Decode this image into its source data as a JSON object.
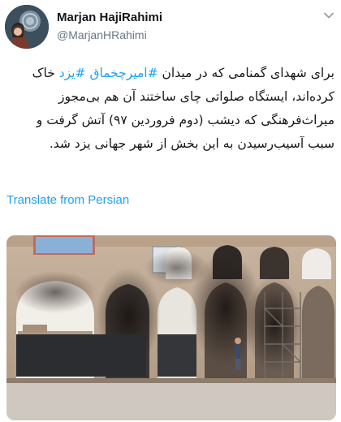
{
  "header": {
    "display_name": "Marjan HajiRahimi",
    "handle": "@MarjanHRahimi"
  },
  "tweet": {
    "line1_prefix": "برای شهدای گمنامی که در میدان ",
    "tag1": "#امیرچخماق",
    "line1_between": " ",
    "tag2": "#یزد",
    "rest": " خاک کرده‌اند، ایستگاه صلواتی چای ساختند آن هم بی‌مجوز میراث‌فرهنگی که دیشب (دوم فروردین ۹۷) آتش گرفت و سبب آسیب‌رسیدن به این بخش از شهر جهانی یزد شد."
  },
  "translate_label": "Translate from Persian",
  "colors": {
    "link": "#1da1f2",
    "text": "#14171a",
    "secondary": "#657786"
  },
  "icons": {
    "menu": "chevron-down-icon"
  }
}
